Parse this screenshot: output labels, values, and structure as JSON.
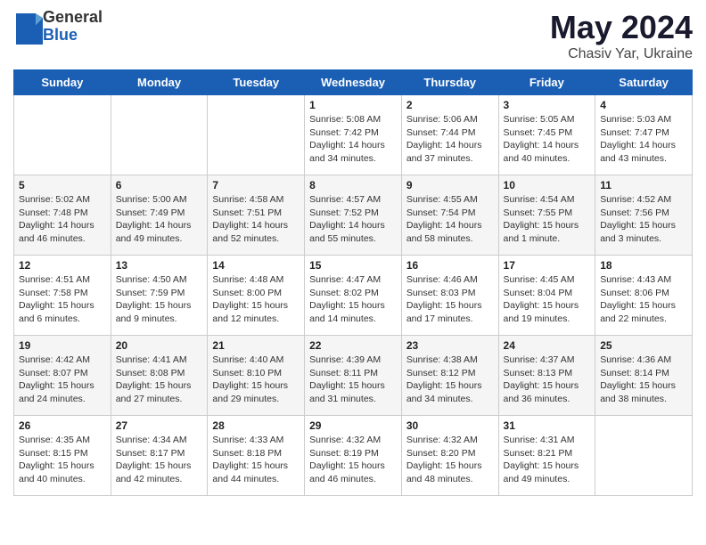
{
  "logo": {
    "general": "General",
    "blue": "Blue"
  },
  "title": "May 2024",
  "subtitle": "Chasiv Yar, Ukraine",
  "days_of_week": [
    "Sunday",
    "Monday",
    "Tuesday",
    "Wednesday",
    "Thursday",
    "Friday",
    "Saturday"
  ],
  "weeks": [
    [
      {
        "day": "",
        "info": ""
      },
      {
        "day": "",
        "info": ""
      },
      {
        "day": "",
        "info": ""
      },
      {
        "day": "1",
        "info": "Sunrise: 5:08 AM\nSunset: 7:42 PM\nDaylight: 14 hours\nand 34 minutes."
      },
      {
        "day": "2",
        "info": "Sunrise: 5:06 AM\nSunset: 7:44 PM\nDaylight: 14 hours\nand 37 minutes."
      },
      {
        "day": "3",
        "info": "Sunrise: 5:05 AM\nSunset: 7:45 PM\nDaylight: 14 hours\nand 40 minutes."
      },
      {
        "day": "4",
        "info": "Sunrise: 5:03 AM\nSunset: 7:47 PM\nDaylight: 14 hours\nand 43 minutes."
      }
    ],
    [
      {
        "day": "5",
        "info": "Sunrise: 5:02 AM\nSunset: 7:48 PM\nDaylight: 14 hours\nand 46 minutes."
      },
      {
        "day": "6",
        "info": "Sunrise: 5:00 AM\nSunset: 7:49 PM\nDaylight: 14 hours\nand 49 minutes."
      },
      {
        "day": "7",
        "info": "Sunrise: 4:58 AM\nSunset: 7:51 PM\nDaylight: 14 hours\nand 52 minutes."
      },
      {
        "day": "8",
        "info": "Sunrise: 4:57 AM\nSunset: 7:52 PM\nDaylight: 14 hours\nand 55 minutes."
      },
      {
        "day": "9",
        "info": "Sunrise: 4:55 AM\nSunset: 7:54 PM\nDaylight: 14 hours\nand 58 minutes."
      },
      {
        "day": "10",
        "info": "Sunrise: 4:54 AM\nSunset: 7:55 PM\nDaylight: 15 hours\nand 1 minute."
      },
      {
        "day": "11",
        "info": "Sunrise: 4:52 AM\nSunset: 7:56 PM\nDaylight: 15 hours\nand 3 minutes."
      }
    ],
    [
      {
        "day": "12",
        "info": "Sunrise: 4:51 AM\nSunset: 7:58 PM\nDaylight: 15 hours\nand 6 minutes."
      },
      {
        "day": "13",
        "info": "Sunrise: 4:50 AM\nSunset: 7:59 PM\nDaylight: 15 hours\nand 9 minutes."
      },
      {
        "day": "14",
        "info": "Sunrise: 4:48 AM\nSunset: 8:00 PM\nDaylight: 15 hours\nand 12 minutes."
      },
      {
        "day": "15",
        "info": "Sunrise: 4:47 AM\nSunset: 8:02 PM\nDaylight: 15 hours\nand 14 minutes."
      },
      {
        "day": "16",
        "info": "Sunrise: 4:46 AM\nSunset: 8:03 PM\nDaylight: 15 hours\nand 17 minutes."
      },
      {
        "day": "17",
        "info": "Sunrise: 4:45 AM\nSunset: 8:04 PM\nDaylight: 15 hours\nand 19 minutes."
      },
      {
        "day": "18",
        "info": "Sunrise: 4:43 AM\nSunset: 8:06 PM\nDaylight: 15 hours\nand 22 minutes."
      }
    ],
    [
      {
        "day": "19",
        "info": "Sunrise: 4:42 AM\nSunset: 8:07 PM\nDaylight: 15 hours\nand 24 minutes."
      },
      {
        "day": "20",
        "info": "Sunrise: 4:41 AM\nSunset: 8:08 PM\nDaylight: 15 hours\nand 27 minutes."
      },
      {
        "day": "21",
        "info": "Sunrise: 4:40 AM\nSunset: 8:10 PM\nDaylight: 15 hours\nand 29 minutes."
      },
      {
        "day": "22",
        "info": "Sunrise: 4:39 AM\nSunset: 8:11 PM\nDaylight: 15 hours\nand 31 minutes."
      },
      {
        "day": "23",
        "info": "Sunrise: 4:38 AM\nSunset: 8:12 PM\nDaylight: 15 hours\nand 34 minutes."
      },
      {
        "day": "24",
        "info": "Sunrise: 4:37 AM\nSunset: 8:13 PM\nDaylight: 15 hours\nand 36 minutes."
      },
      {
        "day": "25",
        "info": "Sunrise: 4:36 AM\nSunset: 8:14 PM\nDaylight: 15 hours\nand 38 minutes."
      }
    ],
    [
      {
        "day": "26",
        "info": "Sunrise: 4:35 AM\nSunset: 8:15 PM\nDaylight: 15 hours\nand 40 minutes."
      },
      {
        "day": "27",
        "info": "Sunrise: 4:34 AM\nSunset: 8:17 PM\nDaylight: 15 hours\nand 42 minutes."
      },
      {
        "day": "28",
        "info": "Sunrise: 4:33 AM\nSunset: 8:18 PM\nDaylight: 15 hours\nand 44 minutes."
      },
      {
        "day": "29",
        "info": "Sunrise: 4:32 AM\nSunset: 8:19 PM\nDaylight: 15 hours\nand 46 minutes."
      },
      {
        "day": "30",
        "info": "Sunrise: 4:32 AM\nSunset: 8:20 PM\nDaylight: 15 hours\nand 48 minutes."
      },
      {
        "day": "31",
        "info": "Sunrise: 4:31 AM\nSunset: 8:21 PM\nDaylight: 15 hours\nand 49 minutes."
      },
      {
        "day": "",
        "info": ""
      }
    ]
  ]
}
